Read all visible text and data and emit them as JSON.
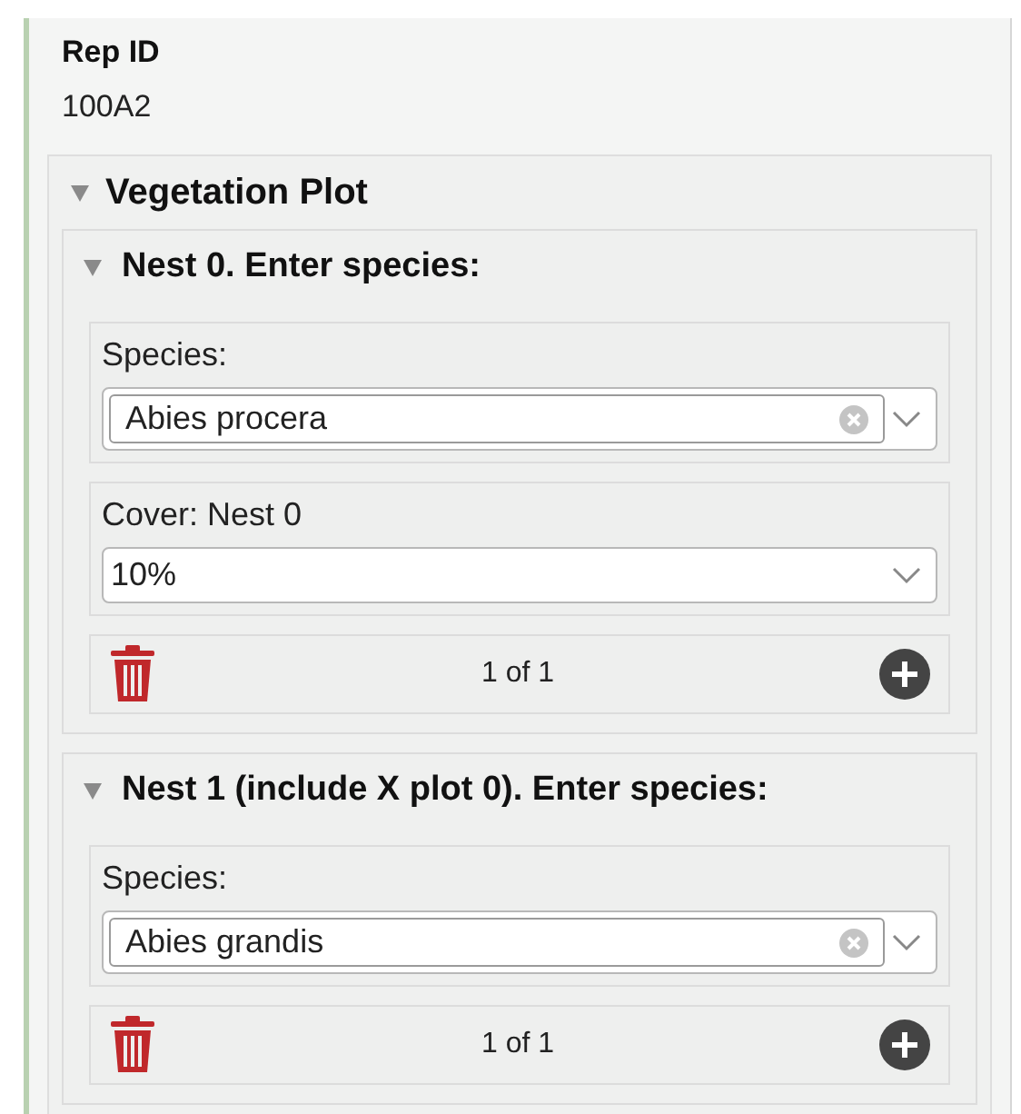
{
  "rep_id": {
    "label": "Rep ID",
    "value": "100A2"
  },
  "group": {
    "title": "Vegetation Plot",
    "expanded": true,
    "nests": [
      {
        "title": "Nest 0. Enter species:",
        "expanded": true,
        "fields": [
          {
            "kind": "combo",
            "label": "Species:",
            "value": "Abies procera"
          },
          {
            "kind": "select",
            "label": "Cover: Nest 0",
            "value": "10%"
          }
        ],
        "counter": "1 of 1"
      },
      {
        "title": "Nest 1 (include X plot 0). Enter species:",
        "expanded": true,
        "fields": [
          {
            "kind": "combo",
            "label": "Species:",
            "value": "Abies grandis"
          }
        ],
        "counter": "1 of 1"
      }
    ]
  }
}
